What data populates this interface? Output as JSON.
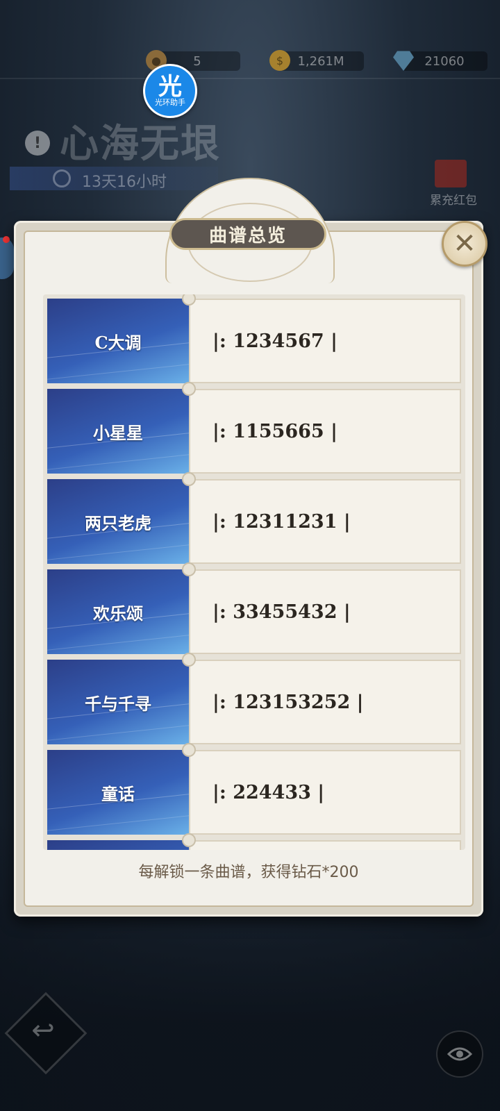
{
  "currencies": [
    {
      "icon": "token-icon",
      "value": "5"
    },
    {
      "icon": "gold-coin-icon",
      "value": "1,261M"
    },
    {
      "icon": "diamond-icon",
      "value": "21060"
    }
  ],
  "assistant": {
    "glyph": "光",
    "label": "光环助手"
  },
  "event": {
    "title": "心海无垠",
    "timer": "13天16小时",
    "redpack_label": "累充红包"
  },
  "modal": {
    "title": "曲谱总览",
    "close_symbol": "✕",
    "footer": "每解锁一条曲谱，获得钻石*200",
    "songs": [
      {
        "name": "C大调",
        "score": "|: 1234567 |"
      },
      {
        "name": "小星星",
        "score": "|: 1155665 |"
      },
      {
        "name": "两只老虎",
        "score": "|: 12311231 |"
      },
      {
        "name": "欢乐颂",
        "score": "|: 33455432 |"
      },
      {
        "name": "千与千寻",
        "score": "|: 123153252 |"
      },
      {
        "name": "童话",
        "score": "|: 224433 |"
      }
    ]
  },
  "controls": {
    "back_symbol": "↩",
    "eye_icon": "eye-icon"
  },
  "colors": {
    "accent_gold": "#cdbb8f",
    "card_blue": "#3560b8",
    "panel_bg": "#f2f0ea"
  }
}
